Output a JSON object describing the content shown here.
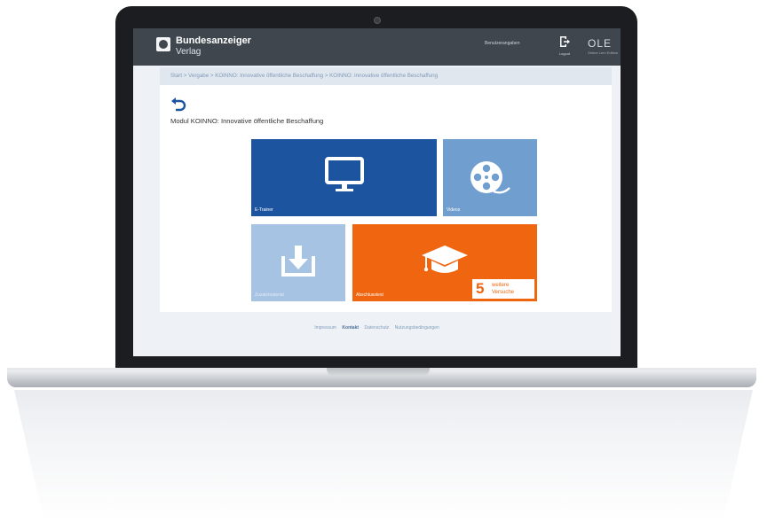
{
  "header": {
    "logo_name": "Bundesanzeiger",
    "logo_sub": "Verlag",
    "user_name": "Benutzerangaben",
    "logout_label": "Logout",
    "brand": "OLE",
    "brand_sub": "Online Lern Edition"
  },
  "breadcrumb": "Start > Vergabe > KOINNO: Innovative öffentliche Beschaffung > KOINNO: Innovative öffentliche Beschaffung",
  "module_title": "Modul KOINNO: Innovative öffentliche Beschaffung",
  "tiles": {
    "etrainer": "E-Trainer",
    "videos": "Videos",
    "download": "Zusatzmaterial",
    "exam": "Abschlusstest"
  },
  "attempts": {
    "count": "5",
    "line1": "weitere",
    "line2": "Versuche"
  },
  "footer": {
    "impressum": "Impressum",
    "kontakt": "Kontakt",
    "datenschutz": "Datenschutz",
    "nutzung": "Nutzungsbedingungen"
  },
  "colors": {
    "header": "#3f464e",
    "tile_etrainer": "#1c54a0",
    "tile_videos": "#6f9ecf",
    "tile_download": "#a6c3e4",
    "tile_exam": "#f0650f",
    "link": "#7f9ab9"
  },
  "icons": [
    "back-arrow-icon",
    "monitor-icon",
    "film-reel-icon",
    "download-icon",
    "graduation-cap-icon",
    "logout-icon"
  ]
}
